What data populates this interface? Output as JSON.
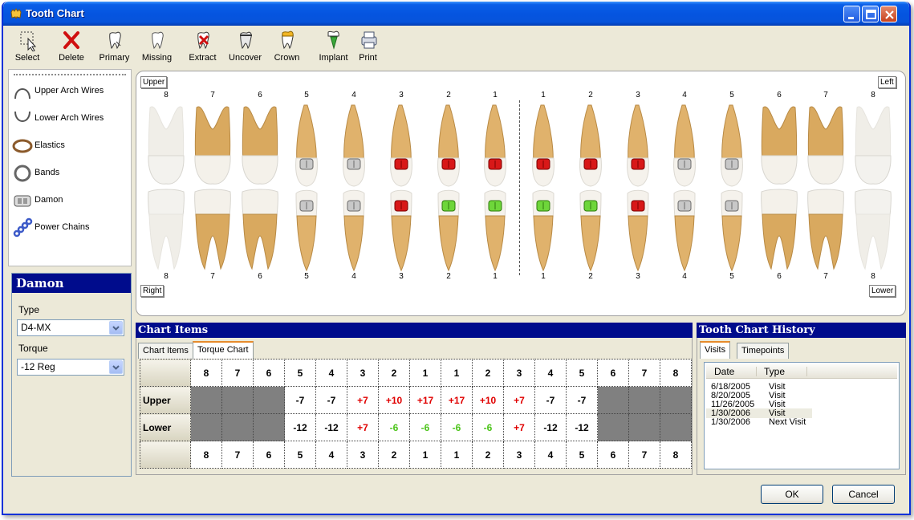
{
  "window": {
    "title": "Tooth Chart"
  },
  "toolbar": [
    {
      "label": "Select",
      "icon": "select-icon"
    },
    {
      "label": "Delete",
      "icon": "delete-icon"
    },
    {
      "label": "Primary",
      "icon": "primary-tooth-icon"
    },
    {
      "label": "Missing",
      "icon": "missing-tooth-icon"
    },
    {
      "label": "Extract",
      "icon": "extract-tooth-icon"
    },
    {
      "label": "Uncover",
      "icon": "uncover-tooth-icon"
    },
    {
      "label": "Crown",
      "icon": "crown-tooth-icon"
    },
    {
      "label": "Implant",
      "icon": "implant-tooth-icon"
    },
    {
      "label": "Print",
      "icon": "printer-icon"
    }
  ],
  "appliances": [
    {
      "label": "Upper Arch Wires",
      "icon": "upper-arch-wire-icon"
    },
    {
      "label": "Lower Arch Wires",
      "icon": "lower-arch-wire-icon"
    },
    {
      "label": "Elastics",
      "icon": "elastic-icon"
    },
    {
      "label": "Bands",
      "icon": "band-icon"
    },
    {
      "label": "Damon",
      "icon": "damon-bracket-icon"
    },
    {
      "label": "Power Chains",
      "icon": "power-chain-icon"
    }
  ],
  "damon": {
    "title": "Damon",
    "type_label": "Type",
    "type_value": "D4-MX",
    "torque_label": "Torque",
    "torque_value": "-12 Reg"
  },
  "chart": {
    "upper_label": "Upper",
    "left_label": "Left",
    "right_label": "Right",
    "lower_label": "Lower",
    "tooth_numbers": [
      "8",
      "7",
      "6",
      "5",
      "4",
      "3",
      "2",
      "1",
      "1",
      "2",
      "3",
      "4",
      "5",
      "6",
      "7",
      "8"
    ],
    "upper_brackets": [
      "none",
      "none",
      "none",
      "silver",
      "silver",
      "red",
      "red",
      "red",
      "red",
      "red",
      "red",
      "silver",
      "silver",
      "none",
      "none",
      "none"
    ],
    "lower_brackets": [
      "none",
      "none",
      "none",
      "silver",
      "silver",
      "red",
      "green",
      "green",
      "green",
      "green",
      "red",
      "silver",
      "silver",
      "none",
      "none",
      "none"
    ]
  },
  "chart_items": {
    "title": "Chart Items",
    "tabs": [
      "Chart Items",
      "Torque Chart"
    ],
    "active_tab": "Torque Chart",
    "teeth": [
      "8",
      "7",
      "6",
      "5",
      "4",
      "3",
      "2",
      "1",
      "1",
      "2",
      "3",
      "4",
      "5",
      "6",
      "7",
      "8"
    ],
    "rows": [
      {
        "label": "Upper",
        "values": [
          "",
          "",
          "",
          "-7",
          "-7",
          "+7",
          "+10",
          "+17",
          "+17",
          "+10",
          "+7",
          "-7",
          "-7",
          "",
          "",
          ""
        ]
      },
      {
        "label": "Lower",
        "values": [
          "",
          "",
          "",
          "-12",
          "-12",
          "+7",
          "-6",
          "-6",
          "-6",
          "-6",
          "+7",
          "-12",
          "-12",
          "",
          "",
          ""
        ]
      }
    ],
    "colors": {
      "positive": "#e00000",
      "green": "#4cc41a",
      "negative": "#000000",
      "empty": "#808080"
    }
  },
  "history": {
    "title": "Tooth Chart History",
    "tabs": [
      "Visits",
      "Timepoints"
    ],
    "active_tab": "Visits",
    "columns": [
      "Date",
      "Type"
    ],
    "rows": [
      {
        "date": "6/18/2005",
        "type": "Visit"
      },
      {
        "date": "8/20/2005",
        "type": "Visit"
      },
      {
        "date": "11/26/2005",
        "type": "Visit"
      },
      {
        "date": "1/30/2006",
        "type": "Visit"
      },
      {
        "date": "1/30/2006",
        "type": "Next Visit"
      }
    ],
    "selected_index": 3
  },
  "buttons": {
    "ok": "OK",
    "cancel": "Cancel"
  }
}
